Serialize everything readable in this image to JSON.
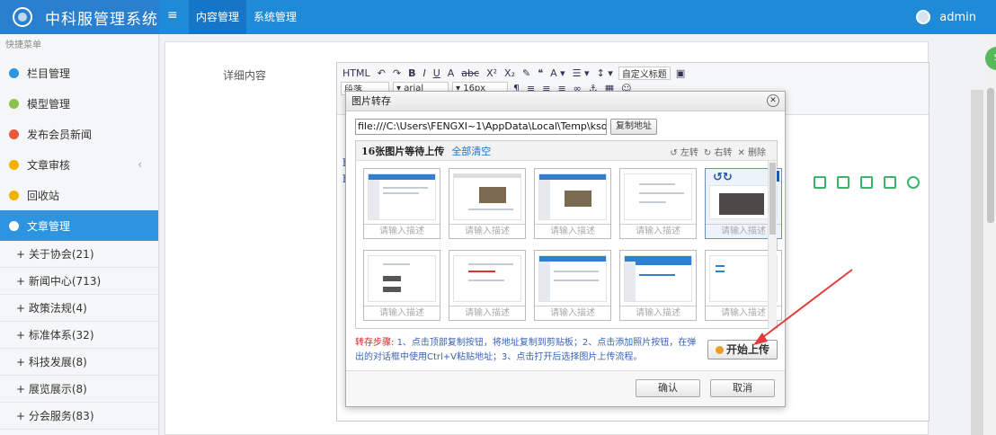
{
  "app": {
    "title": "中科服管理系统",
    "user": "admin"
  },
  "topnav": [
    {
      "label": "内容管理",
      "active": true
    },
    {
      "label": "系统管理",
      "active": false
    }
  ],
  "sidebar": {
    "header": "快捷菜单",
    "items": [
      {
        "label": "栏目管理",
        "color": "#2f94e0"
      },
      {
        "label": "模型管理",
        "color": "#8bc34a"
      },
      {
        "label": "发布会员新闻",
        "color": "#e75a3c"
      },
      {
        "label": "文章审核",
        "color": "#f0b400",
        "caret": "‹"
      },
      {
        "label": "回收站",
        "color": "#f0b400"
      },
      {
        "label": "文章管理",
        "color": "#ffffff",
        "active": true
      }
    ],
    "subitems": [
      "+ 关于协会(21)",
      "+ 新闻中心(713)",
      "+ 政策法规(4)",
      "+ 标准体系(32)",
      "+ 科技发展(8)",
      "+ 展览展示(8)",
      "+ 分会服务(83)"
    ]
  },
  "form": {
    "label": "详细内容"
  },
  "editor": {
    "paragraph": "段落",
    "font": "arial",
    "size": "16px",
    "custom_title": "自定义标题",
    "body_lines": [
      "ht",
      "ht"
    ]
  },
  "dialog": {
    "title": "图片转存",
    "url_value": "file:///C:\\Users\\FENGXI~1\\AppData\\Local\\Temp\\ksohtml139",
    "copy_btn": "复制地址",
    "count_text": "16张图片等待上传",
    "clear_all": "全部清空",
    "ops": {
      "rotate_left": "左转",
      "rotate_right": "右转",
      "delete": "删除"
    },
    "desc_placeholder": "请输入描述",
    "steps_red": "转存步骤:",
    "steps_text": "1、点击顶部复制按钮，将地址复制到剪贴板；2、点击添加照片按钮，在弹出的对话框中使用Ctrl+V粘贴地址；3、点击打开后选择图片上传流程。",
    "start_btn": "开始上传",
    "ok": "确认",
    "cancel": "取消"
  }
}
